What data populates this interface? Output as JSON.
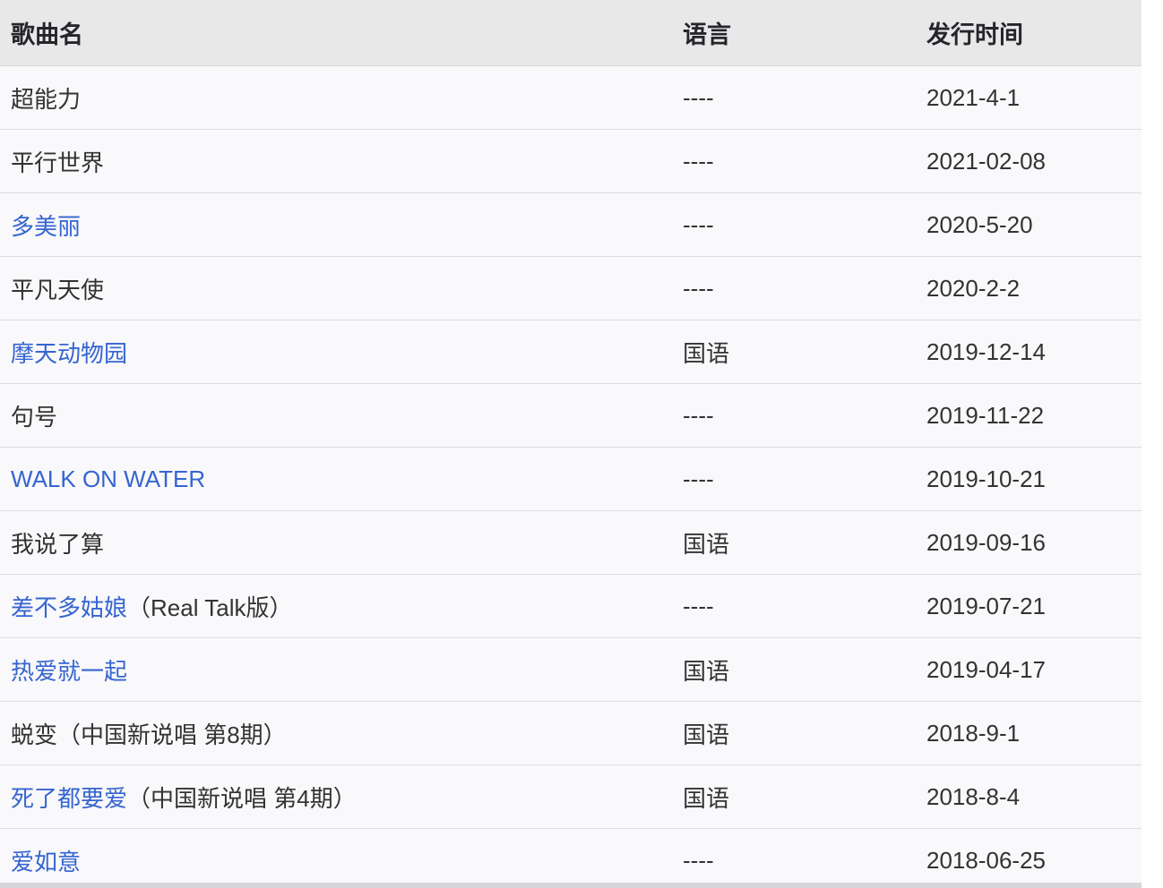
{
  "table": {
    "columns": [
      {
        "label": "歌曲名"
      },
      {
        "label": "语言"
      },
      {
        "label": "发行时间"
      }
    ],
    "rows": [
      {
        "name": "超能力",
        "is_link": false,
        "suffix": "",
        "language": "----",
        "date": "2021-4-1"
      },
      {
        "name": "平行世界",
        "is_link": false,
        "suffix": "",
        "language": "----",
        "date": "2021-02-08"
      },
      {
        "name": "多美丽",
        "is_link": true,
        "suffix": "",
        "language": "----",
        "date": "2020-5-20"
      },
      {
        "name": "平凡天使",
        "is_link": false,
        "suffix": "",
        "language": "----",
        "date": "2020-2-2"
      },
      {
        "name": "摩天动物园",
        "is_link": true,
        "suffix": "",
        "language": "国语",
        "date": "2019-12-14"
      },
      {
        "name": "句号",
        "is_link": false,
        "suffix": "",
        "language": "----",
        "date": "2019-11-22"
      },
      {
        "name": "WALK ON WATER",
        "is_link": true,
        "suffix": "",
        "language": "----",
        "date": "2019-10-21"
      },
      {
        "name": "我说了算",
        "is_link": false,
        "suffix": "",
        "language": "国语",
        "date": "2019-09-16"
      },
      {
        "name": "差不多姑娘",
        "is_link": true,
        "suffix": "（Real Talk版）",
        "language": "----",
        "date": "2019-07-21"
      },
      {
        "name": "热爱就一起",
        "is_link": true,
        "suffix": "",
        "language": "国语",
        "date": "2019-04-17"
      },
      {
        "name": "蜕变（中国新说唱 第8期）",
        "is_link": false,
        "suffix": "",
        "language": "国语",
        "date": "2018-9-1"
      },
      {
        "name": "死了都要爱",
        "is_link": true,
        "suffix": "（中国新说唱 第4期）",
        "language": "国语",
        "date": "2018-8-4"
      },
      {
        "name": "爱如意",
        "is_link": true,
        "suffix": "",
        "language": "----",
        "date": "2018-06-25"
      }
    ]
  },
  "colors": {
    "link_blue": "#3565d0",
    "header_bg": "#e9e8e8",
    "header_text": "#26252b",
    "row_bg": "#f9f8fa",
    "text_dark": "#333333",
    "separator": "#dedde1"
  }
}
